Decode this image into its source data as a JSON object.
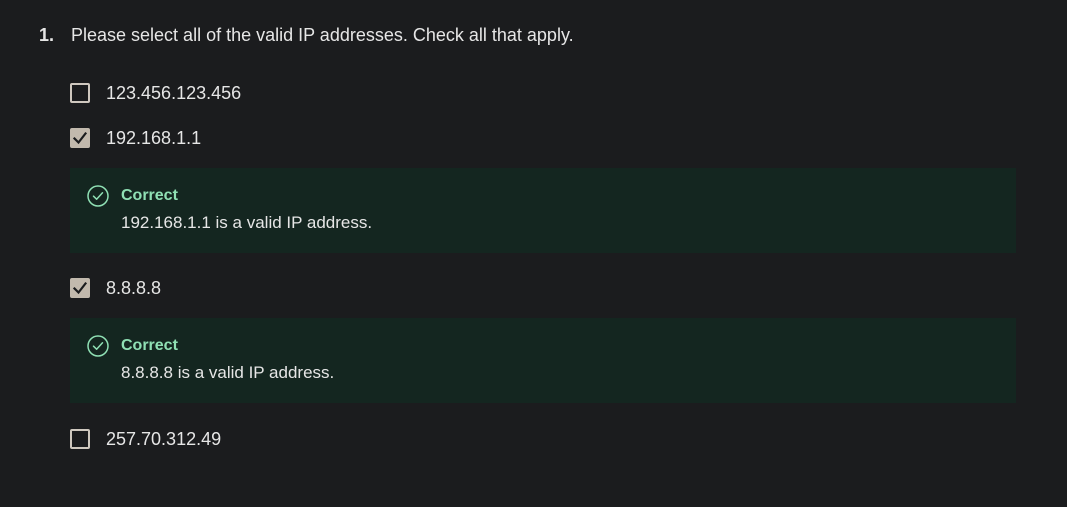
{
  "question": {
    "number": "1.",
    "text": "Please select all of the valid IP addresses. Check all that apply."
  },
  "options": [
    {
      "label": "123.456.123.456",
      "checked": false
    },
    {
      "label": "192.168.1.1",
      "checked": true
    },
    {
      "label": "8.8.8.8",
      "checked": true
    },
    {
      "label": "257.70.312.49",
      "checked": false
    }
  ],
  "feedback": [
    {
      "title": "Correct",
      "text": "192.168.1.1 is a valid IP address."
    },
    {
      "title": "Correct",
      "text": "8.8.8.8 is a valid IP address."
    }
  ],
  "colors": {
    "background": "#1b1c1e",
    "feedback_background": "#142620",
    "correct_accent": "#8fe0b4",
    "checkbox_checked": "#c2b9ad"
  },
  "icons": {
    "checkmark": "checkmark-icon",
    "correct": "check-circle-icon"
  }
}
